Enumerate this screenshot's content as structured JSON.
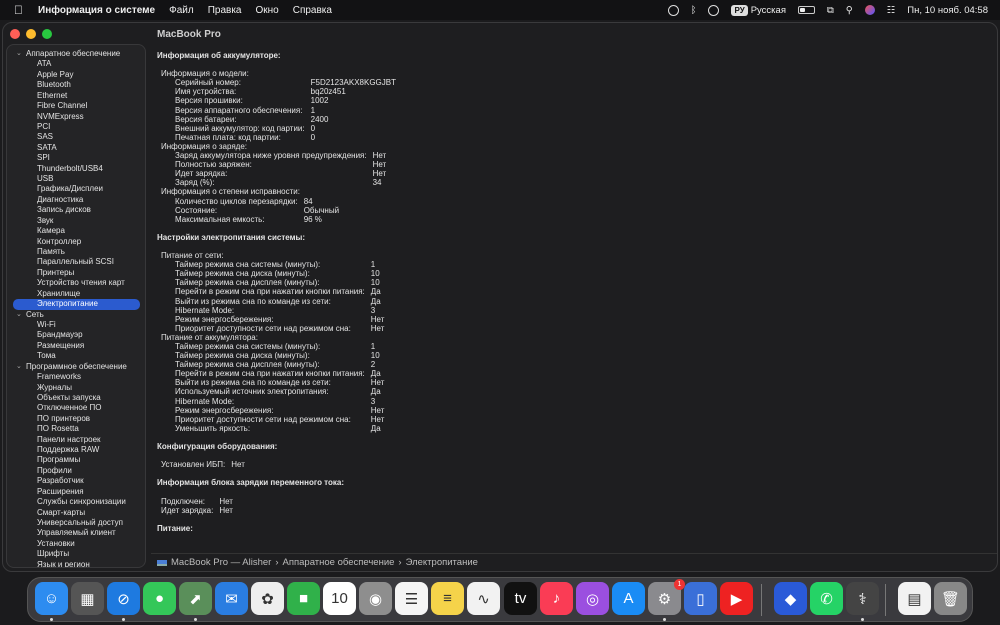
{
  "menubar": {
    "app": "Информация о системе",
    "menus": [
      "Файл",
      "Правка",
      "Окно",
      "Справка"
    ],
    "input_badge": "РУ",
    "input_lang": "Русская",
    "datetime": "Пн, 10 нояб. 04:58"
  },
  "window": {
    "title": "MacBook Pro"
  },
  "sidebar": [
    {
      "label": "Аппаратное обеспечение",
      "items": [
        "ATA",
        "Apple Pay",
        "Bluetooth",
        "Ethernet",
        "Fibre Channel",
        "NVMExpress",
        "PCI",
        "SAS",
        "SATA",
        "SPI",
        "Thunderbolt/USB4",
        "USB",
        "Графика/Дисплеи",
        "Диагностика",
        "Запись дисков",
        "Звук",
        "Камера",
        "Контроллер",
        "Память",
        "Параллельный SCSI",
        "Принтеры",
        "Устройство чтения карт",
        "Хранилище",
        "Электропитание"
      ]
    },
    {
      "label": "Сеть",
      "items": [
        "Wi-Fi",
        "Брандмауэр",
        "Размещения",
        "Тома"
      ]
    },
    {
      "label": "Программное обеспечение",
      "items": [
        "Frameworks",
        "Журналы",
        "Объекты запуска",
        "Отключенное ПО",
        "ПО принтеров",
        "ПО Rosetta",
        "Панели настроек",
        "Поддержка RAW",
        "Программы",
        "Профили",
        "Разработчик",
        "Расширения",
        "Службы синхронизации",
        "Смарт-карты",
        "Универсальный доступ",
        "Управляемый клиент",
        "Установки",
        "Шрифты",
        "Язык и регион"
      ]
    }
  ],
  "selected_item": "Электропитание",
  "content": [
    {
      "title": "Информация об аккумуляторе:",
      "groups": [
        {
          "title": "Информация о модели:",
          "items": [
            [
              "Серийный номер:",
              "F5D2123AKX8KGGJBT"
            ],
            [
              "Имя устройства:",
              "bq20z451"
            ],
            [
              "Версия прошивки:",
              "1002"
            ],
            [
              "Версия аппаратного обеспечения:",
              "1"
            ],
            [
              "Версия батареи:",
              "2400"
            ],
            [
              "Внешний аккумулятор: код партии:",
              "0"
            ],
            [
              "Печатная плата: код партии:",
              "0"
            ]
          ]
        },
        {
          "title": "Информация о заряде:",
          "items": [
            [
              "Заряд аккумулятора ниже уровня предупреждения:",
              "Нет"
            ],
            [
              "Полностью заряжен:",
              "Нет"
            ],
            [
              "Идет зарядка:",
              "Нет"
            ],
            [
              "Заряд (%):",
              "34"
            ]
          ]
        },
        {
          "title": "Информация о степени исправности:",
          "items": [
            [
              "Количество циклов перезарядки:",
              "84"
            ],
            [
              "Состояние:",
              "Обычный"
            ],
            [
              "Максимальная емкость:",
              "96 %"
            ]
          ]
        }
      ]
    },
    {
      "title": "Настройки электропитания системы:",
      "groups": [
        {
          "title": "Питание от сети:",
          "items": [
            [
              "Таймер режима сна системы (минуты):",
              "1"
            ],
            [
              "Таймер режима сна диска (минуты):",
              "10"
            ],
            [
              "Таймер режима сна дисплея (минуты):",
              "10"
            ],
            [
              "Перейти в режим сна при нажатии кнопки питания:",
              "Да"
            ],
            [
              "Выйти из режима сна по команде из сети:",
              "Да"
            ],
            [
              "Hibernate Mode:",
              "3"
            ],
            [
              "Режим энергосбережения:",
              "Нет"
            ],
            [
              "Приоритет доступности сети над режимом сна:",
              "Нет"
            ]
          ]
        },
        {
          "title": "Питание от аккумулятора:",
          "items": [
            [
              "Таймер режима сна системы (минуты):",
              "1"
            ],
            [
              "Таймер режима сна диска (минуты):",
              "10"
            ],
            [
              "Таймер режима сна дисплея (минуты):",
              "2"
            ],
            [
              "Перейти в режим сна при нажатии кнопки питания:",
              "Да"
            ],
            [
              "Выйти из режима сна по команде из сети:",
              "Нет"
            ],
            [
              "Используемый источник электропитания:",
              "Да"
            ],
            [
              "Hibernate Mode:",
              "3"
            ],
            [
              "Режим энергосбережения:",
              "Нет"
            ],
            [
              "Приоритет доступности сети над режимом сна:",
              "Нет"
            ],
            [
              "Уменьшить яркость:",
              "Да"
            ]
          ]
        }
      ]
    },
    {
      "title": "Конфигурация оборудования:",
      "groups": [
        {
          "title": null,
          "items": [
            [
              "Установлен ИБП:",
              "Нет"
            ]
          ]
        }
      ]
    },
    {
      "title": "Информация блока зарядки переменного тока:",
      "groups": [
        {
          "title": null,
          "items": [
            [
              "Подключен:",
              "Нет"
            ],
            [
              "Идет зарядка:",
              "Нет"
            ]
          ]
        }
      ]
    },
    {
      "title": "Питание:",
      "groups": []
    }
  ],
  "statusbar": {
    "path": [
      "MacBook Pro — Alisher",
      "Аппаратное обеспечение",
      "Электропитание"
    ]
  },
  "dock": {
    "apps": [
      {
        "name": "finder",
        "color": "#2d8cf0",
        "glyph": "☺",
        "running": true
      },
      {
        "name": "launchpad",
        "color": "#555",
        "glyph": "▦"
      },
      {
        "name": "safari",
        "color": "#1e7ae0",
        "glyph": "⊘",
        "running": true
      },
      {
        "name": "messages",
        "color": "#34c759",
        "glyph": "●"
      },
      {
        "name": "maps",
        "color": "#5a8f5a",
        "glyph": "⬈",
        "running": true
      },
      {
        "name": "mail",
        "color": "#2a7de1",
        "glyph": "✉"
      },
      {
        "name": "photos",
        "color": "#eeeeee",
        "glyph": "✿"
      },
      {
        "name": "facetime",
        "color": "#30b14a",
        "glyph": "■"
      },
      {
        "name": "calendar",
        "color": "#ffffff",
        "glyph": "10"
      },
      {
        "name": "contacts",
        "color": "#8e8e8e",
        "glyph": "◉"
      },
      {
        "name": "reminders",
        "color": "#f5f5f5",
        "glyph": "☰"
      },
      {
        "name": "notes",
        "color": "#f5d34a",
        "glyph": "≡"
      },
      {
        "name": "freeform",
        "color": "#f2f2f2",
        "glyph": "∿"
      },
      {
        "name": "tv",
        "color": "#111111",
        "glyph": "tv"
      },
      {
        "name": "music",
        "color": "#fa3c55",
        "glyph": "♪"
      },
      {
        "name": "podcasts",
        "color": "#9b4fe0",
        "glyph": "◎"
      },
      {
        "name": "app-store",
        "color": "#1a8cf5",
        "glyph": "A"
      },
      {
        "name": "system-settings",
        "color": "#8a8a8e",
        "glyph": "⚙",
        "running": true,
        "badge": "1"
      },
      {
        "name": "iphone-mirroring",
        "color": "#3a6fd8",
        "glyph": "▯"
      },
      {
        "name": "youtube",
        "color": "#e22",
        "glyph": "▶"
      },
      {
        "name": "roblox",
        "color": "#2a5ad8",
        "glyph": "◆"
      },
      {
        "name": "whatsapp",
        "color": "#25d366",
        "glyph": "✆"
      },
      {
        "name": "system-information",
        "color": "#444",
        "glyph": "⚕",
        "running": true
      },
      {
        "name": "document",
        "color": "#f2f2f2",
        "glyph": "▤"
      },
      {
        "name": "trash",
        "color": "#888",
        "glyph": "🗑"
      }
    ]
  }
}
